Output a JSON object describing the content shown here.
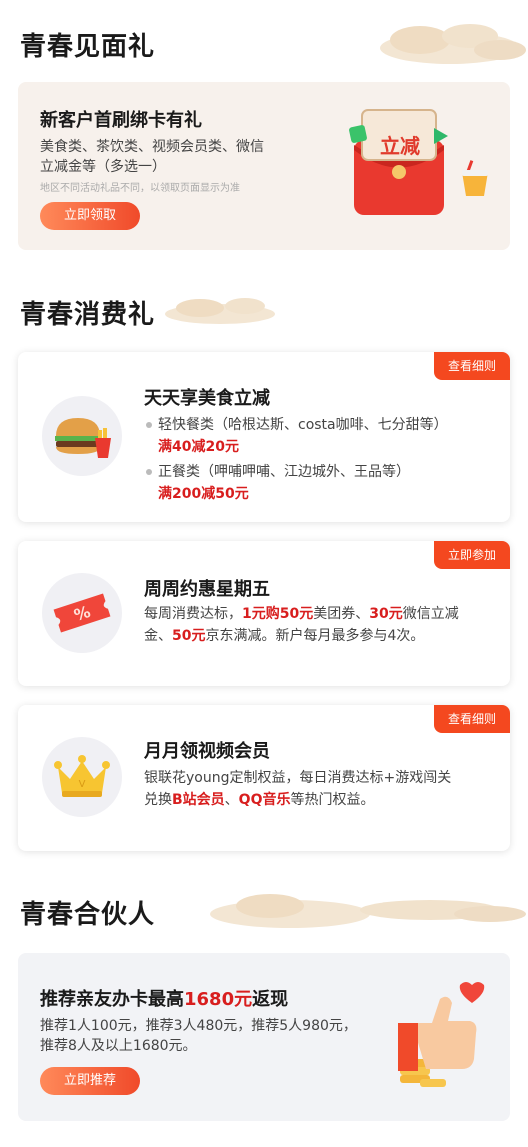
{
  "sections": {
    "meet": {
      "title": "青春见面礼"
    },
    "consume": {
      "title": "青春消费礼"
    },
    "partner": {
      "title": "青春合伙人"
    }
  },
  "newcard": {
    "title": "新客户首刷绑卡有礼",
    "desc_line1": "美食类、茶饮类、视频会员类、微信",
    "desc_line2": "立减金等（多选一）",
    "note": "地区不同活动礼品不同，以领取页面显示为准",
    "button": "立即领取",
    "envelope_label": "立减"
  },
  "food": {
    "tag": "查看细则",
    "title": "天天享美食立减",
    "item1": "轻快餐类（哈根达斯、costa咖啡、七分甜等）",
    "item1_offer": "满40减20元",
    "item2": "正餐类（呷哺呷哺、江边城外、王品等）",
    "item2_offer": "满200减50元"
  },
  "friday": {
    "tag": "立即参加",
    "title": "周周约惠星期五",
    "line1_a": "每周消费达标，",
    "line1_b": "1元购50元",
    "line1_c": "美团券、",
    "line1_d": "30元",
    "line1_e": "微信立减",
    "line2_a": "金、",
    "line2_b": "50元",
    "line2_c": "京东满减。新户每月最多参与4次。"
  },
  "video": {
    "tag": "查看细则",
    "title": "月月领视频会员",
    "line1": "银联花young定制权益，每日消费达标+游戏闯关",
    "line2_a": "兑换",
    "line2_b": "B站会员",
    "line2_c": "、",
    "line2_d": "QQ音乐",
    "line2_e": "等热门权益。"
  },
  "recommend": {
    "title_a": "推荐亲友办卡最高",
    "title_b": "1680元",
    "title_c": "返现",
    "line1": "推荐1人100元，推荐3人480元，推荐5人980元，",
    "line2": "推荐8人及以上1680元。",
    "button": "立即推荐"
  },
  "colors": {
    "accent": "#f4481f",
    "highlight": "#d81e1e",
    "beige": "#f7f1ec",
    "gray_card": "#f2f3f6"
  },
  "icons": [
    "cloud-decoration",
    "red-envelope-icon",
    "drink-cup-icon",
    "burger-fries-icon",
    "coupon-ticket-icon",
    "crown-icon",
    "thumbs-up-coins-icon"
  ]
}
